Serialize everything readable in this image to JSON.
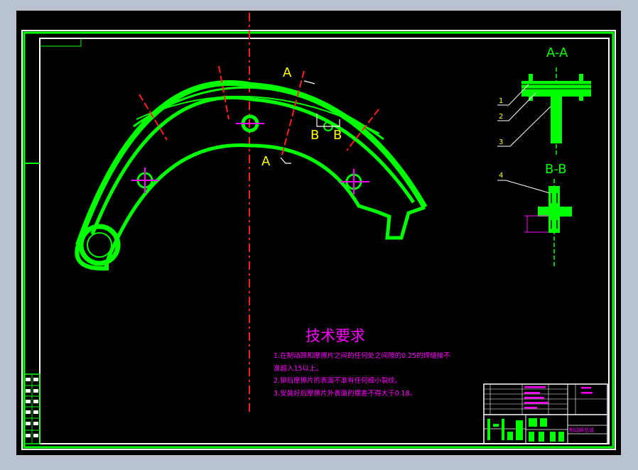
{
  "colors": {
    "background": "#000000",
    "frame": "#00ff00",
    "centerline": "#ff2020",
    "label": "#ffff00",
    "annotation": "#ff00ff",
    "leader": "#ffffff",
    "outer_border": "#b9c3cf"
  },
  "section_labels": {
    "aa_title": "A-A",
    "bb_title": "B-B",
    "a_upper": "A",
    "a_lower": "A",
    "b_left": "B",
    "b_right": "B"
  },
  "part_callouts": [
    "1",
    "2",
    "3",
    "4"
  ],
  "tech_requirements": {
    "title": "技术要求",
    "items": [
      "1.在制动蹄和摩擦片之间的任何处之间隙的0.25的焊缝接不",
      "准超入15以上。",
      "2.铆后摩擦片的表面不准有任何细小裂纹。",
      "3.安装好后摩擦片外表面的摆差不得大于0.18。"
    ]
  },
  "title_block": {
    "drawing_name": "制动蹄总成"
  }
}
